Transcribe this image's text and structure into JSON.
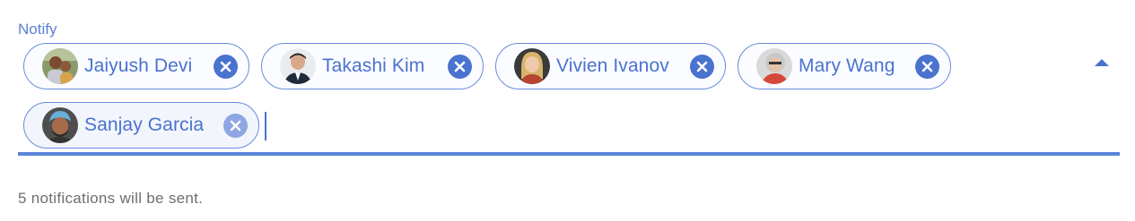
{
  "field": {
    "label": "Notify"
  },
  "recipients": [
    {
      "name": "Jaiyush Devi",
      "avatar": "person-photo-adult-with-child"
    },
    {
      "name": "Takashi Kim",
      "avatar": "person-photo-man-in-suit"
    },
    {
      "name": "Vivien Ivanov",
      "avatar": "person-photo-woman-blonde"
    },
    {
      "name": "Mary Wang",
      "avatar": "person-photo-older-woman-grey-hair"
    },
    {
      "name": "Sanjay Garcia",
      "avatar": "person-photo-man-in-turban"
    }
  ],
  "helper": {
    "text": "5 notifications will be sent."
  },
  "colors": {
    "accent": "#4a72cf",
    "label": "#5b7fd6",
    "underline": "#5b84d9",
    "helper_text": "#6e6e6e"
  },
  "icons": {
    "remove": "close-circle-icon",
    "toggle": "caret-up-icon"
  }
}
